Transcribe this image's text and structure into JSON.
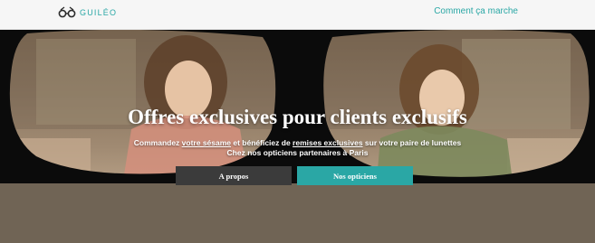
{
  "header": {
    "logo_text": "GUILÉO",
    "nav_link": "Comment ça marche"
  },
  "hero": {
    "title": "Offres exclusives pour clients exclusifs",
    "subtitle_part1": "Commandez ",
    "subtitle_link1": "votre sésame",
    "subtitle_part2": " et bénéficiez de ",
    "subtitle_link2": "remises exclusives",
    "subtitle_part3": " sur votre paire de lunettes",
    "subtitle_line2": "Chez nos opticiens partenaires à Paris",
    "buttons": {
      "about": "A propos",
      "opticians": "Nos opticiens"
    }
  },
  "colors": {
    "accent": "#2aa7a5",
    "dark_button": "#3b3b3b",
    "frame": "#0b0b0b"
  },
  "icons": {
    "logo": "glasses-logo-icon"
  }
}
